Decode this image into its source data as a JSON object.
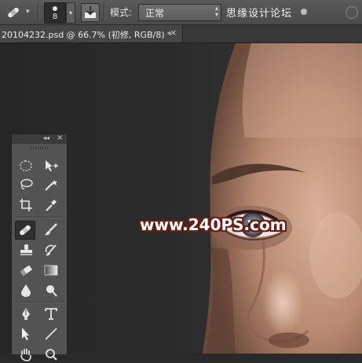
{
  "options_bar": {
    "brush_size": "8",
    "mode_label": "模式:",
    "mode_value": "正常",
    "overlay_text": "思缘设计论坛"
  },
  "document_tab": {
    "title": "20104232.psd @ 66.7% (初修, RGB/8) *",
    "close_symbol": "×"
  },
  "canvas": {
    "watermark": "www.240PS.com"
  },
  "tools_panel": {
    "collapse_symbol": "◂◂",
    "close_symbol": "×"
  },
  "colors": {
    "ui_dark": "#2a2a2a",
    "panel_gray": "#535353",
    "watermark_outline": "#6a1f14",
    "skin": "#c79a82"
  }
}
